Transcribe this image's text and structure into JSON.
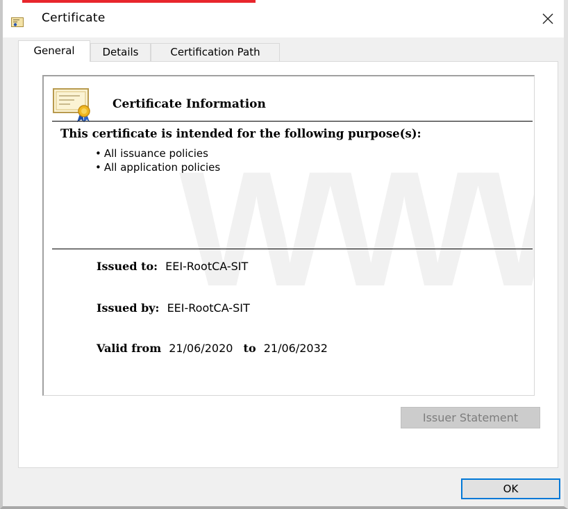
{
  "window": {
    "title": "Certificate",
    "icon": "certificate-icon",
    "close_icon": "close-icon"
  },
  "tabs": [
    {
      "label": "General",
      "active": true
    },
    {
      "label": "Details",
      "active": false
    },
    {
      "label": "Certification Path",
      "active": false
    }
  ],
  "info": {
    "title": "Certificate Information",
    "purpose_heading": "This certificate is intended for the following purpose(s):",
    "purposes": [
      "All issuance policies",
      "All application policies"
    ],
    "issued_to_label": "Issued to:",
    "issued_to_value": "EEI-RootCA-SIT",
    "issued_by_label": "Issued by:",
    "issued_by_value": "EEI-RootCA-SIT",
    "valid_from_label": "Valid from",
    "valid_from_value": "21/06/2020",
    "valid_to_label": "to",
    "valid_to_value": "21/06/2032"
  },
  "buttons": {
    "issuer_statement": "Issuer Statement",
    "ok": "OK"
  },
  "colors": {
    "focus_border": "#0078d7",
    "accent_strip": "#e8262c",
    "disabled_text": "#7d7d7d"
  }
}
